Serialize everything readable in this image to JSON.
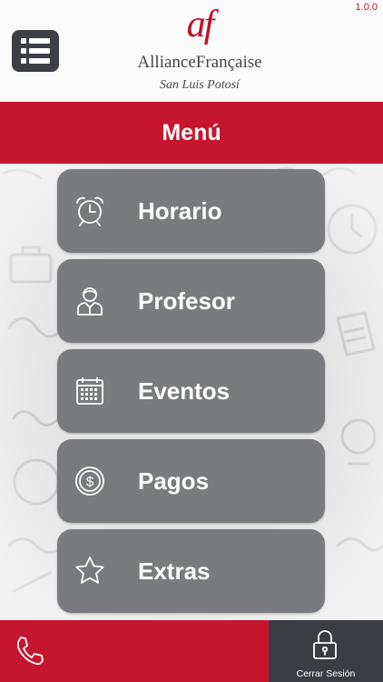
{
  "version": "1.0.0",
  "header": {
    "logo_mark": "af",
    "logo_name": "AllianceFrançaise",
    "logo_city": "San Luis Potosí"
  },
  "title": "Menú",
  "menu": [
    {
      "label": "Horario",
      "icon": "alarm-clock-icon"
    },
    {
      "label": "Profesor",
      "icon": "teacher-icon"
    },
    {
      "label": "Eventos",
      "icon": "calendar-icon"
    },
    {
      "label": "Pagos",
      "icon": "coin-dollar-icon"
    },
    {
      "label": "Extras",
      "icon": "star-icon"
    }
  ],
  "footer": {
    "phone_icon": "phone-icon",
    "logout_label": "Cerrar Sesión",
    "logout_icon": "lock-icon"
  },
  "colors": {
    "brand_red": "#c5162e",
    "card_gray": "#7a7b7e",
    "dark_button": "#3b3d43"
  }
}
